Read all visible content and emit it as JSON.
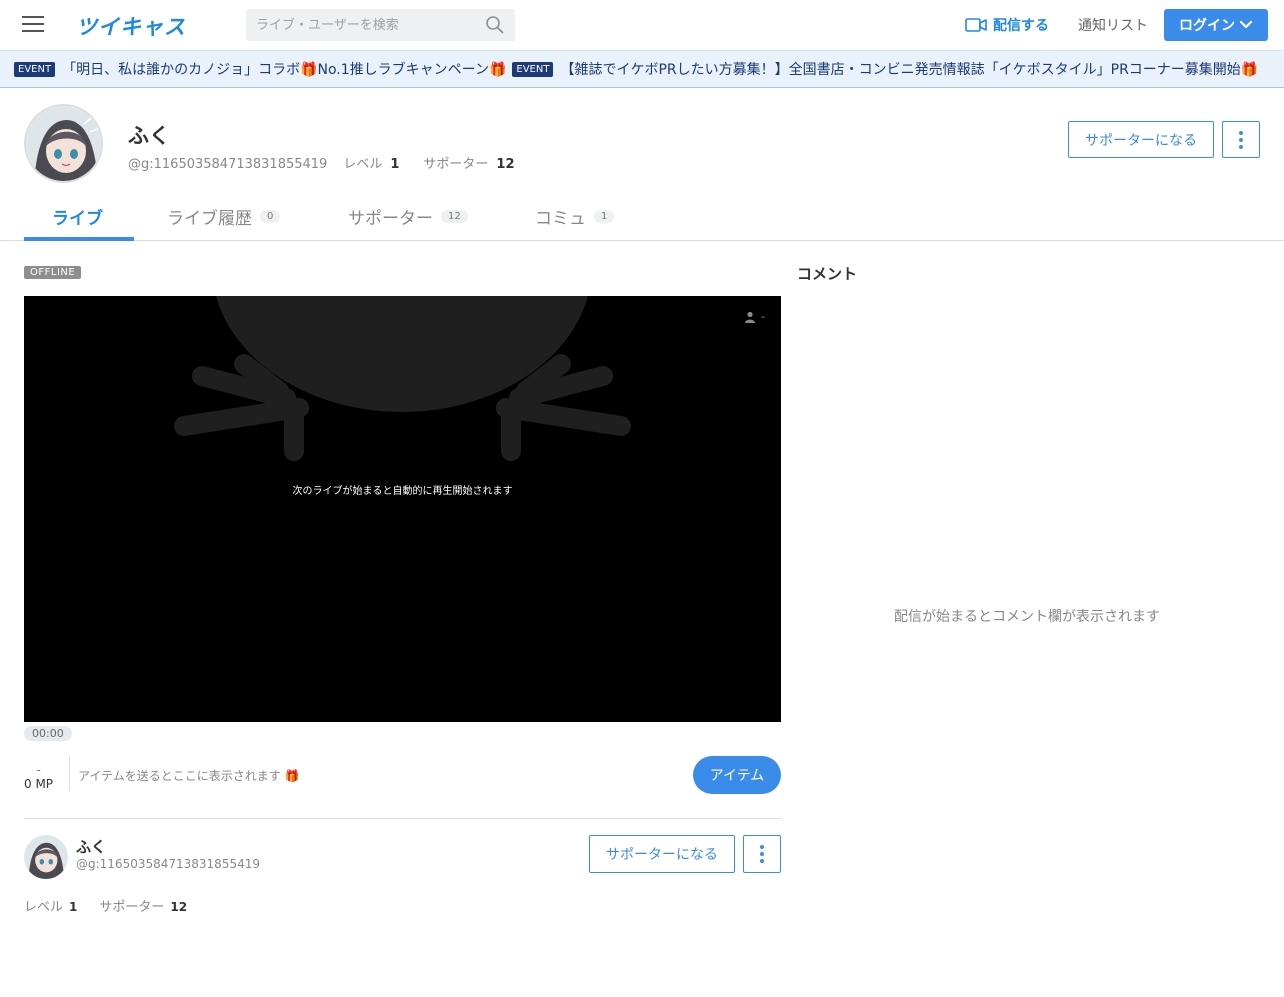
{
  "header": {
    "logo": "ツイキャス",
    "search_placeholder": "ライブ・ユーザーを検索",
    "broadcast_label": "配信する",
    "notify_label": "通知リスト",
    "login_label": "ログイン"
  },
  "events": [
    {
      "badge": "EVENT",
      "text": "「明日、私は誰かのカノジョ」コラボ🎁No.1推しラブキャンペーン🎁"
    },
    {
      "badge": "EVENT",
      "text": "【雑誌でイケボPRしたい方募集！】全国書店・コンビニ発売情報誌「イケボスタイル」PRコーナー募集開始🎁"
    }
  ],
  "profile": {
    "name": "ふく",
    "user_id": "@g:116503584713831855419",
    "level_label": "レベル",
    "level": "1",
    "supporters_label": "サポーター",
    "supporters": "12",
    "support_button": "サポーターになる"
  },
  "tabs": [
    {
      "label": "ライブ",
      "count": ""
    },
    {
      "label": "ライブ履歴",
      "count": "0"
    },
    {
      "label": "サポーター",
      "count": "12"
    },
    {
      "label": "コミュ",
      "count": "1"
    }
  ],
  "player": {
    "status": "OFFLINE",
    "message": "次のライブが始まると自動的に再生開始されます",
    "viewer_count": "-",
    "time": "00:00"
  },
  "items": {
    "mp_dash": "-",
    "mp": "0 MP",
    "message": "アイテムを送るとここに表示されます 🎁",
    "button": "アイテム"
  },
  "comments": {
    "title": "コメント",
    "empty": "配信が始まるとコメント欄が表示されます"
  },
  "colors": {
    "brand": "#1e88e5",
    "button": "#3b8beb",
    "event_badge": "#1c3a78"
  }
}
